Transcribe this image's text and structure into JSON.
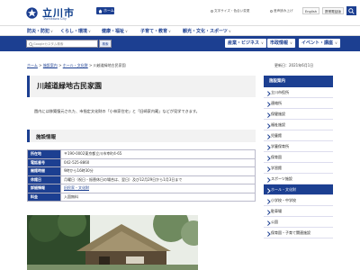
{
  "header": {
    "site_title": "立川市",
    "site_sub": "Tachikawa City",
    "home_label": "ホーム",
    "util_links": [
      "文字サイズ・色合い変更",
      "音声読み上げ"
    ],
    "lang_label": "English",
    "mobile_label": "携帯電話版",
    "search_label": "検索"
  },
  "gnav": {
    "items": [
      "防災・防犯",
      "くらし・環境",
      "健康・福祉",
      "子育て・教育",
      "観光・文化・スポーツ"
    ]
  },
  "search_row": {
    "placeholder": "Googleカスタム検索",
    "go_label": "検索",
    "pills": [
      "産業・ビジネス",
      "市政情報",
      "イベント・講座"
    ]
  },
  "breadcrumb": {
    "items": [
      "ホーム",
      "施設案内",
      "ホール・文化財",
      "川越道緑地古民家園"
    ],
    "separator": ">"
  },
  "updated": "更新日：2021年6月1日",
  "page": {
    "title": "川越道緑地古民家園",
    "intro": "園内には移築復元された、市指定文化財の「小林家住宅」と「旧崎家内蔵」などが見学できます。",
    "section_title": "施設情報"
  },
  "info_table": [
    {
      "label": "所在地",
      "value": "〒190-0002東京都立川市幸町4-65"
    },
    {
      "label": "電話番号",
      "value": "042-525-8860"
    },
    {
      "label": "開館時間",
      "value": "9時から16時30分"
    },
    {
      "label": "休館日",
      "value": "月曜日（祝日・振替休日の場合は、翌日）及び12月29日から1月3日まで"
    },
    {
      "label": "詳細情報",
      "value": "旧民家・文化財"
    },
    {
      "label": "料金",
      "value": "入園無料"
    }
  ],
  "sidebar": {
    "heading": "施設案内",
    "items": [
      "立川市役所",
      "連絡所",
      "保健施設",
      "福祉施設",
      "児童館",
      "学童保育所",
      "保育園",
      "学習館",
      "スポーツ施設",
      "ホール・文化財",
      "小学校・中学校",
      "駐車場",
      "公園",
      "保育園・子育て関連施設"
    ],
    "active_index": 9
  },
  "colors": {
    "brand": "#1c3f91",
    "panel": "#f2f2f2"
  },
  "icons": {
    "logo": "tachikawa-emblem",
    "home": "house-icon",
    "search": "magnifier-icon"
  }
}
